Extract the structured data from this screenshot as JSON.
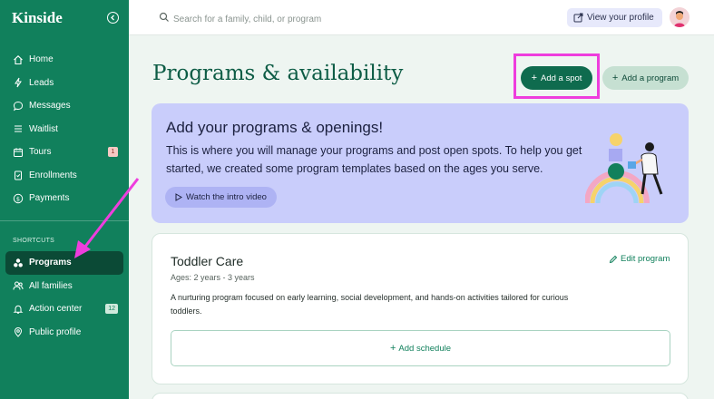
{
  "app": {
    "name": "Kinside"
  },
  "sidebar": {
    "items": [
      {
        "label": "Home",
        "icon": "home-icon"
      },
      {
        "label": "Leads",
        "icon": "bolt-icon"
      },
      {
        "label": "Messages",
        "icon": "chat-icon"
      },
      {
        "label": "Waitlist",
        "icon": "list-icon"
      },
      {
        "label": "Tours",
        "icon": "calendar-icon",
        "badge": "1"
      },
      {
        "label": "Enrollments",
        "icon": "clipboard-icon"
      },
      {
        "label": "Payments",
        "icon": "dollar-icon"
      }
    ],
    "shortcuts_heading": "SHORTCUTS",
    "shortcuts": [
      {
        "label": "Programs",
        "icon": "programs-icon",
        "active": true
      },
      {
        "label": "All families",
        "icon": "families-icon"
      },
      {
        "label": "Action center",
        "icon": "bell-icon",
        "badge": "12"
      },
      {
        "label": "Public profile",
        "icon": "location-pin-icon"
      }
    ]
  },
  "topbar": {
    "search_placeholder": "Search for a family, child, or program",
    "view_profile_label": "View your profile"
  },
  "page": {
    "title": "Programs & availability",
    "add_spot_label": "Add a spot",
    "add_program_label": "Add a program"
  },
  "intro": {
    "title": "Add your programs & openings!",
    "text": "This is where you will manage your programs and post open spots. To help you get started, we created some program templates based on the ages you serve.",
    "video_label": "Watch the intro video"
  },
  "program": {
    "name": "Toddler Care",
    "ages": "Ages: 2 years - 3 years",
    "description": "A nurturing program focused on early learning, social development, and hands-on activities tailored for curious toddlers.",
    "edit_label": "Edit program",
    "add_schedule_label": "Add schedule"
  },
  "colors": {
    "brand": "#11805c",
    "highlight": "#ee3ddd",
    "intro_bg": "#c9cdfb"
  }
}
